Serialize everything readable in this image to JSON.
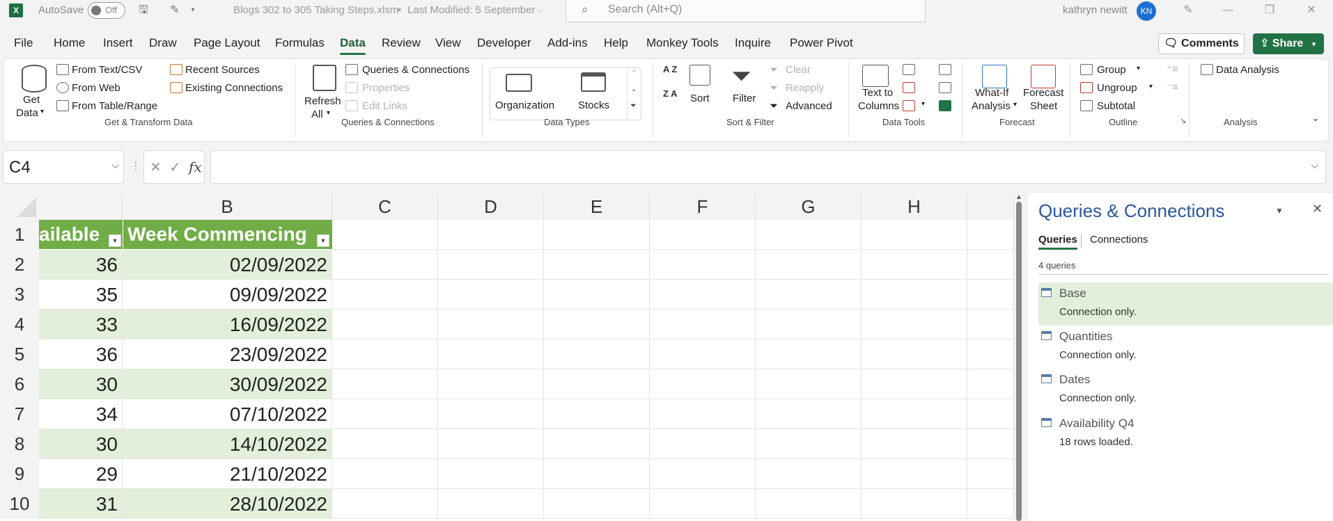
{
  "titlebar": {
    "app_icon": "X",
    "autosave_label": "AutoSave",
    "autosave_state": "Off",
    "filename": "Blogs 302 to 305 Taking Steps.xlsm",
    "bullet": "•",
    "modified": "Last Modified: 5 September",
    "search_placeholder": "Search (Alt+Q)",
    "user_name": "kathryn newitt",
    "user_initials": "KN"
  },
  "menu": {
    "items": [
      "File",
      "Home",
      "Insert",
      "Draw",
      "Page Layout",
      "Formulas",
      "Data",
      "Review",
      "View",
      "Developer",
      "Add-ins",
      "Help",
      "Monkey Tools",
      "Inquire",
      "Power Pivot"
    ],
    "active": "Data",
    "comments_label": "Comments",
    "share_label": "Share"
  },
  "ribbon": {
    "get_transform": {
      "get_data_line1": "Get",
      "get_data_line2": "Data",
      "from_text_csv": "From Text/CSV",
      "from_web": "From Web",
      "from_table_range": "From Table/Range",
      "recent_sources": "Recent Sources",
      "existing_connections": "Existing Connections",
      "group_label": "Get & Transform Data"
    },
    "queries": {
      "refresh_line1": "Refresh",
      "refresh_line2": "All",
      "queries_connections": "Queries & Connections",
      "properties": "Properties",
      "edit_links": "Edit Links",
      "group_label": "Queries & Connections"
    },
    "data_types": {
      "organization": "Organization",
      "stocks": "Stocks",
      "group_label": "Data Types"
    },
    "sort_filter": {
      "sort_az": "A Z",
      "sort_za": "Z A",
      "sort": "Sort",
      "filter": "Filter",
      "clear": "Clear",
      "reapply": "Reapply",
      "advanced": "Advanced",
      "group_label": "Sort & Filter"
    },
    "data_tools": {
      "text_to_columns_line1": "Text to",
      "text_to_columns_line2": "Columns",
      "group_label": "Data Tools"
    },
    "forecast": {
      "what_if_line1": "What-If",
      "what_if_line2": "Analysis",
      "forecast_sheet_line1": "Forecast",
      "forecast_sheet_line2": "Sheet",
      "group_label": "Forecast"
    },
    "outline": {
      "group": "Group",
      "ungroup": "Ungroup",
      "subtotal": "Subtotal",
      "group_label": "Outline"
    },
    "analysis": {
      "data_analysis": "Data Analysis",
      "group_label": "Analysis"
    }
  },
  "formula_bar": {
    "name_box": "C4",
    "fx": "fx",
    "cancel": "✕",
    "enter": "✓",
    "content": ""
  },
  "sheet": {
    "columns": [
      "B",
      "C",
      "D",
      "E",
      "F",
      "G",
      "H"
    ],
    "header_row": {
      "col_a": "ailable",
      "col_b": "Week Commencing"
    },
    "rows": [
      {
        "num": "1"
      },
      {
        "num": "2",
        "a": "36",
        "b": "02/09/2022"
      },
      {
        "num": "3",
        "a": "35",
        "b": "09/09/2022"
      },
      {
        "num": "4",
        "a": "33",
        "b": "16/09/2022"
      },
      {
        "num": "5",
        "a": "36",
        "b": "23/09/2022"
      },
      {
        "num": "6",
        "a": "30",
        "b": "30/09/2022"
      },
      {
        "num": "7",
        "a": "34",
        "b": "07/10/2022"
      },
      {
        "num": "8",
        "a": "30",
        "b": "14/10/2022"
      },
      {
        "num": "9",
        "a": "29",
        "b": "21/10/2022"
      },
      {
        "num": "10",
        "a": "31",
        "b": "28/10/2022"
      }
    ]
  },
  "queries_pane": {
    "title": "Queries & Connections",
    "tabs": [
      "Queries",
      "Connections"
    ],
    "active_tab": "Queries",
    "count": "4 queries",
    "items": [
      {
        "name": "Base",
        "status": "Connection only."
      },
      {
        "name": "Quantities",
        "status": "Connection only."
      },
      {
        "name": "Dates",
        "status": "Connection only."
      },
      {
        "name": "Availability Q4",
        "status": "18 rows loaded."
      }
    ]
  },
  "colors": {
    "excel_green": "#217346",
    "table_header": "#70ad47",
    "table_band": "#e2efda",
    "pane_title": "#2b579a"
  }
}
